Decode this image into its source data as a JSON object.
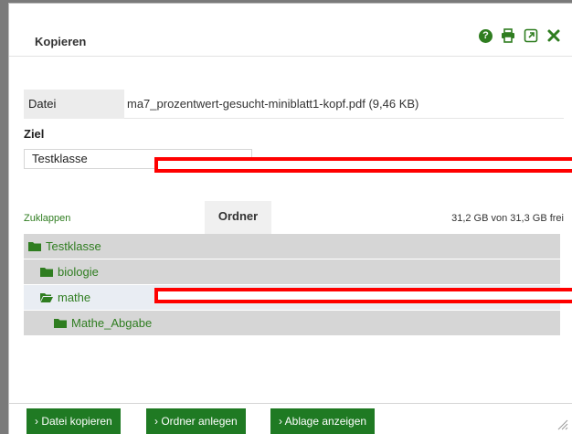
{
  "dialog": {
    "title": "Kopieren",
    "icons": [
      "help-icon",
      "print-icon",
      "popout-icon",
      "close-icon"
    ]
  },
  "file": {
    "label": "Datei",
    "value": "ma7_prozentwert-gesucht-miniblatt1-kopf.pdf (9,46 KB)"
  },
  "target": {
    "label": "Ziel",
    "selected": "Testklasse"
  },
  "browser": {
    "collapse_label": "Zuklappen",
    "tab_label": "Ordner",
    "free_space": "31,2 GB von 31,3 GB frei"
  },
  "tree": [
    {
      "name": "Testklasse",
      "level": 0,
      "open": false,
      "selected": false
    },
    {
      "name": "biologie",
      "level": 1,
      "open": false,
      "selected": false
    },
    {
      "name": "mathe",
      "level": 1,
      "open": true,
      "selected": true
    },
    {
      "name": "Mathe_Abgabe",
      "level": 2,
      "open": false,
      "selected": false
    }
  ],
  "footer": {
    "copy_label": "› Datei kopieren",
    "create_folder_label": "› Ordner anlegen",
    "show_storage_label": "› Ablage anzeigen"
  },
  "colors": {
    "accent": "#2f7d20",
    "button": "#1f7a23",
    "highlight": "#ff0000"
  }
}
